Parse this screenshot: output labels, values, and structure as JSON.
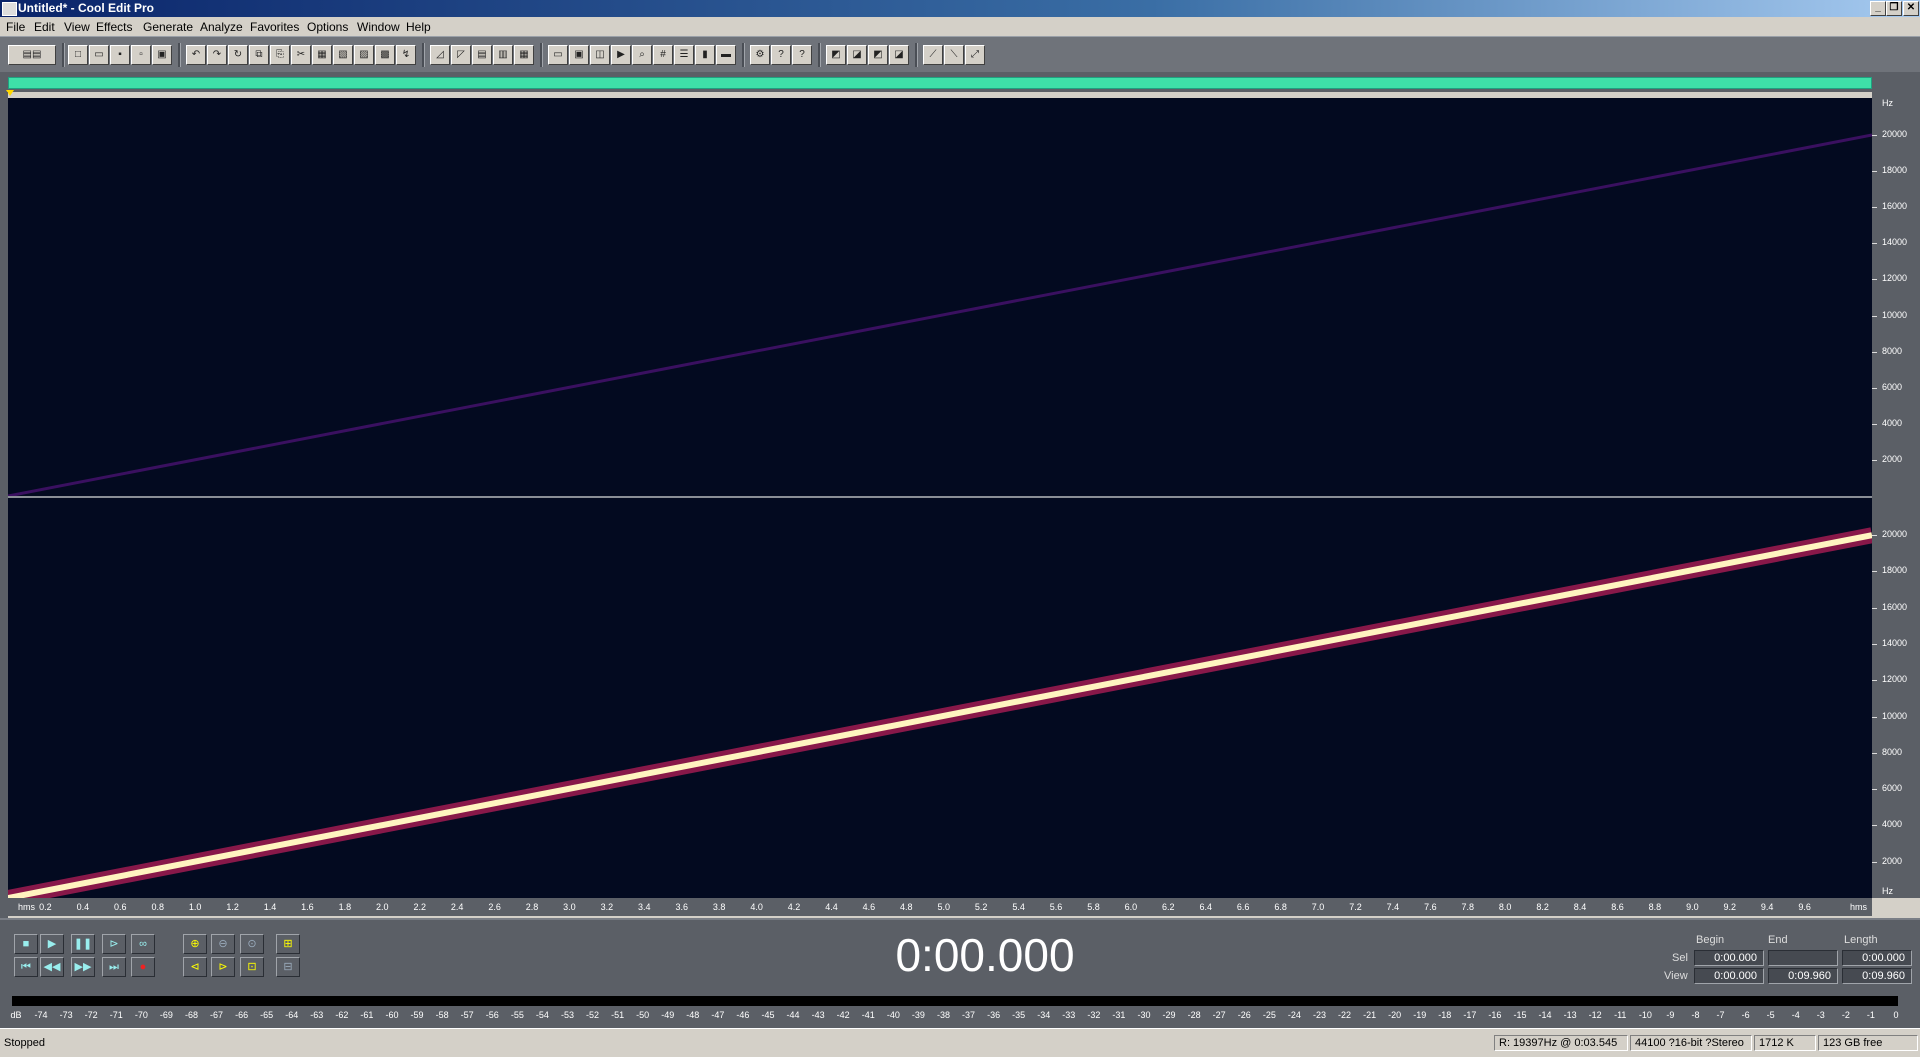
{
  "window": {
    "title": "Untitled* - Cool Edit Pro",
    "controls": [
      "_",
      "❐",
      "✕"
    ]
  },
  "menu": [
    "File",
    "Edit",
    "View",
    "Effects",
    "Generate",
    "Analyze",
    "Favorites",
    "Options",
    "Window",
    "Help"
  ],
  "spectral": {
    "freq_unit": "Hz",
    "freq_ticks": [
      "20000",
      "18000",
      "16000",
      "14000",
      "12000",
      "10000",
      "8000",
      "6000",
      "4000",
      "2000"
    ],
    "sweep_start_hz": 0,
    "sweep_end_hz": 20000,
    "channel_1_intensity": "faint",
    "channel_2_intensity": "strong",
    "colors": {
      "background": "#030a20",
      "sweep_core": "#fff4c0",
      "sweep_glow": "#d02060",
      "faint_sweep": "#3a1060"
    }
  },
  "time_ruler": {
    "start_label": "hms",
    "end_label": "hms",
    "ticks": [
      "0.2",
      "0.4",
      "0.6",
      "0.8",
      "1.0",
      "1.2",
      "1.4",
      "1.6",
      "1.8",
      "2.0",
      "2.2",
      "2.4",
      "2.6",
      "2.8",
      "3.0",
      "3.2",
      "3.4",
      "3.6",
      "3.8",
      "4.0",
      "4.2",
      "4.4",
      "4.6",
      "4.8",
      "5.0",
      "5.2",
      "5.4",
      "5.6",
      "5.8",
      "6.0",
      "6.2",
      "6.4",
      "6.6",
      "6.8",
      "7.0",
      "7.2",
      "7.4",
      "7.6",
      "7.8",
      "8.0",
      "8.2",
      "8.4",
      "8.6",
      "8.8",
      "9.0",
      "9.2",
      "9.4",
      "9.6"
    ],
    "max_seconds": 9.96
  },
  "transport": {
    "time": "0:00.000",
    "headers": {
      "begin": "Begin",
      "end": "End",
      "length": "Length"
    },
    "sel": {
      "label": "Sel",
      "begin": "0:00.000",
      "end": "",
      "length": "0:00.000"
    },
    "view": {
      "label": "View",
      "begin": "0:00.000",
      "end": "0:09.960",
      "length": "0:09.960"
    }
  },
  "meter": {
    "labels": [
      "dB",
      "-74",
      "-73",
      "-72",
      "-71",
      "-70",
      "-69",
      "-68",
      "-67",
      "-66",
      "-65",
      "-64",
      "-63",
      "-62",
      "-61",
      "-60",
      "-59",
      "-58",
      "-57",
      "-56",
      "-55",
      "-54",
      "-53",
      "-52",
      "-51",
      "-50",
      "-49",
      "-48",
      "-47",
      "-46",
      "-45",
      "-44",
      "-43",
      "-42",
      "-41",
      "-40",
      "-39",
      "-38",
      "-37",
      "-36",
      "-35",
      "-34",
      "-33",
      "-32",
      "-31",
      "-30",
      "-29",
      "-28",
      "-27",
      "-26",
      "-25",
      "-24",
      "-23",
      "-22",
      "-21",
      "-20",
      "-19",
      "-18",
      "-17",
      "-16",
      "-15",
      "-14",
      "-13",
      "-12",
      "-11",
      "-10",
      "-9",
      "-8",
      "-7",
      "-6",
      "-5",
      "-4",
      "-3",
      "-2",
      "-1",
      "0"
    ]
  },
  "status": {
    "state": "Stopped",
    "cursor": "R: 19397Hz @   0:03.545",
    "format": "44100 ?16-bit ?Stereo",
    "size": "1712 K",
    "free": "123 GB free"
  }
}
